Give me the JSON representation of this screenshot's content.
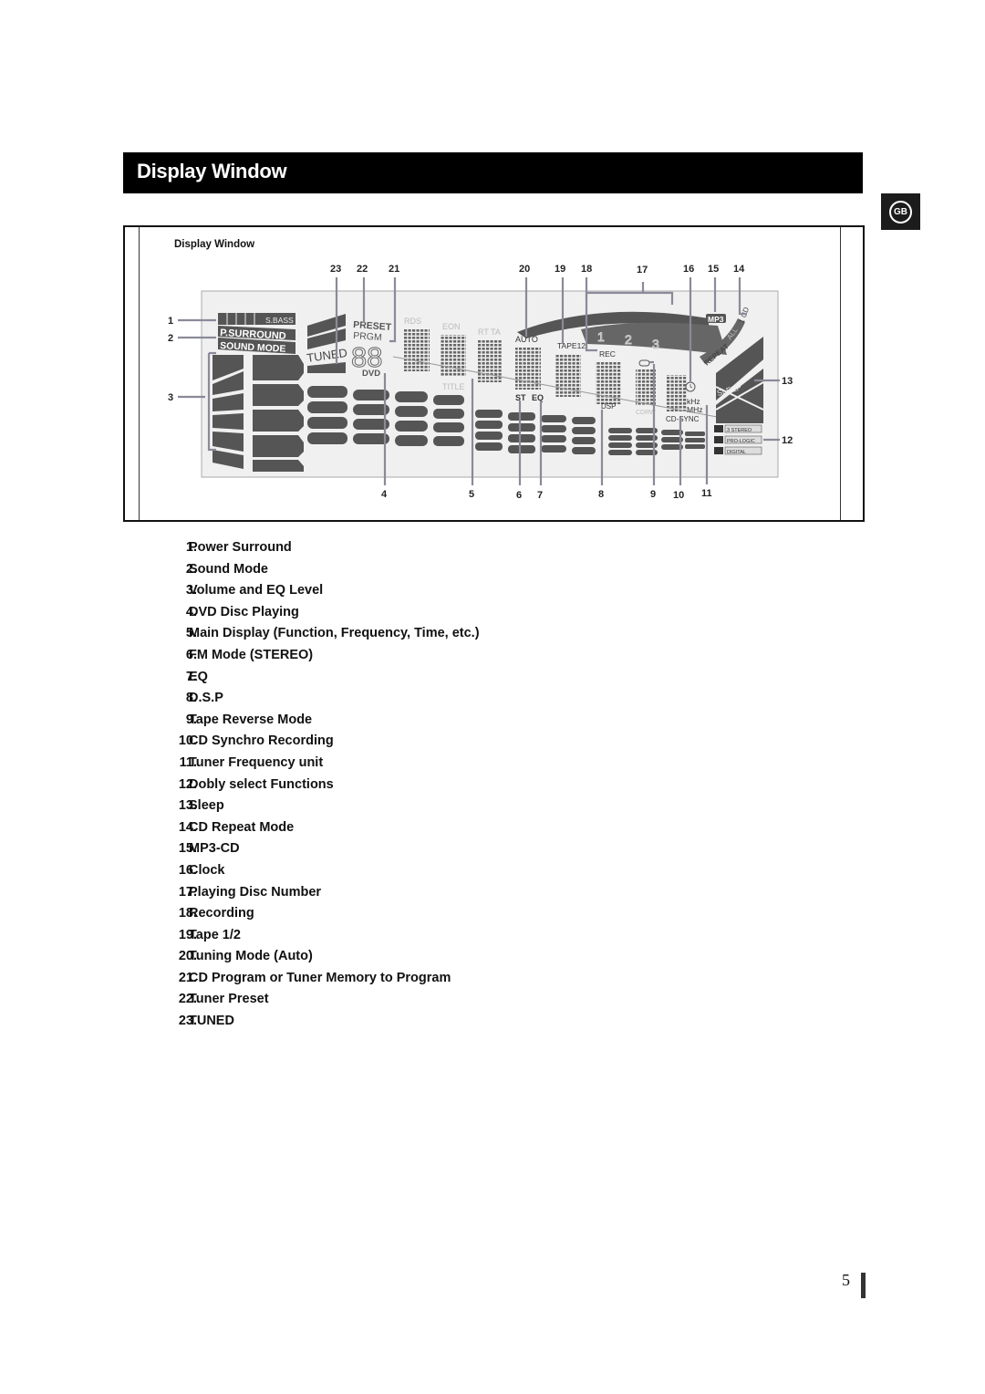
{
  "header": {
    "title": "Display Window",
    "language_tab": "GB"
  },
  "figure": {
    "caption": "Display Window",
    "lcd_labels": {
      "sbass": "S.BASS",
      "p_surround": "P.SURROUND",
      "sound_mode": "SOUND MODE",
      "tuned": "TUNED",
      "preset": "PRESET",
      "prgm": "PRGM",
      "dvd": "DVD",
      "rds": "RDS",
      "eon": "EON",
      "rt_ta": "RT TA",
      "auto": "AUTO",
      "tape12": "TAPE12",
      "rec": "REC",
      "title": "TITLE",
      "st": "ST",
      "eq": "EQ",
      "dsp": "DSP",
      "cdrw": "CDRW",
      "cd_sync": "CD-SYNC",
      "khz": "kHz",
      "mhz": "MHz",
      "mp3": "MP3",
      "repeat": "REPEAT",
      "all": "ALL",
      "one_cd": "1 CD",
      "sleep": "SLEEP",
      "ai": "AI",
      "stereo3": "3 STEREO",
      "pro_logic": "PRO-LOGIC",
      "digital": "DIGITAL",
      "disc1": "1",
      "disc2": "2",
      "disc3": "3",
      "preset_digits": "88"
    },
    "callouts_top": [
      "23",
      "22",
      "21",
      "20",
      "19",
      "18",
      "17",
      "16",
      "15",
      "14"
    ],
    "callouts_bottom": [
      "4",
      "5",
      "6",
      "7",
      "8",
      "9",
      "10",
      "11"
    ],
    "callouts_left": [
      "1",
      "2",
      "3"
    ],
    "callouts_right": [
      "13",
      "12"
    ]
  },
  "legend": [
    {
      "num": "1.",
      "label": "Power Surround"
    },
    {
      "num": "2.",
      "label": "Sound Mode"
    },
    {
      "num": "3.",
      "label": "Volume and EQ Level"
    },
    {
      "num": "4.",
      "label": "DVD Disc Playing"
    },
    {
      "num": "5.",
      "label": "Main Display (Function, Frequency, Time, etc.)"
    },
    {
      "num": "6.",
      "label": "FM Mode (STEREO)"
    },
    {
      "num": "7.",
      "label": "EQ"
    },
    {
      "num": "8.",
      "label": "D.S.P"
    },
    {
      "num": "9.",
      "label": "Tape Reverse Mode"
    },
    {
      "num": "10.",
      "label": "CD Synchro Recording"
    },
    {
      "num": "11.",
      "label": "Tuner Frequency unit"
    },
    {
      "num": "12.",
      "label": "Dobly select Functions"
    },
    {
      "num": "13.",
      "label": "Sleep"
    },
    {
      "num": "14.",
      "label": "CD Repeat Mode"
    },
    {
      "num": "15.",
      "label": "MP3-CD"
    },
    {
      "num": "16.",
      "label": "Clock"
    },
    {
      "num": "17.",
      "label": "Playing Disc Number"
    },
    {
      "num": "18.",
      "label": "Recording"
    },
    {
      "num": "19.",
      "label": "Tape 1/2"
    },
    {
      "num": "20.",
      "label": "Tuning  Mode (Auto)"
    },
    {
      "num": "21.",
      "label": "CD Program or Tuner Memory to Program"
    },
    {
      "num": "22.",
      "label": "Tuner Preset"
    },
    {
      "num": "23.",
      "label": "TUNED"
    }
  ],
  "footer": {
    "page_number": "5"
  }
}
